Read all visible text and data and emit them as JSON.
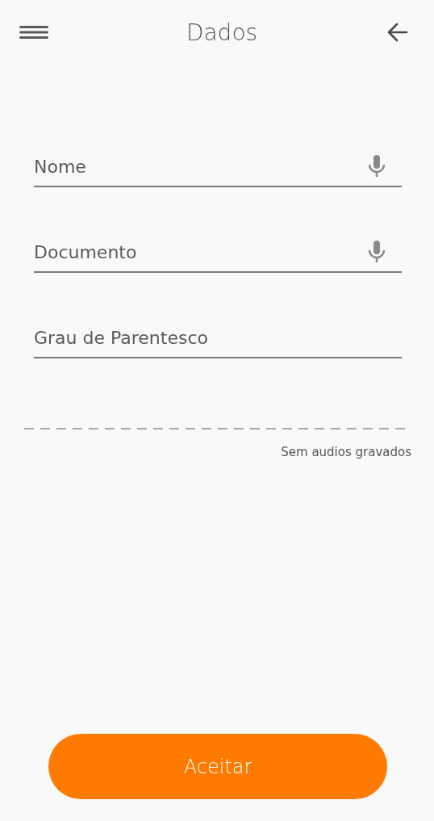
{
  "header": {
    "title": "Dados"
  },
  "fields": [
    {
      "placeholder": "Nome",
      "voice": true
    },
    {
      "placeholder": "Documento",
      "voice": true
    },
    {
      "placeholder": "Grau de Parentesco",
      "voice": false
    }
  ],
  "recordings": {
    "empty_text": "Sem audios gravados"
  },
  "accept_button": "Aceitar"
}
